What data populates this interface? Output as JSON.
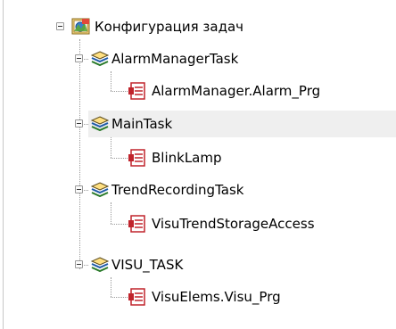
{
  "tree": {
    "root": {
      "label": "Конфигурация задач",
      "icon": "task-configuration-icon"
    },
    "tasks": [
      {
        "label": "AlarmManagerTask",
        "icon": "task-stack-icon",
        "children": [
          {
            "label": "AlarmManager.Alarm_Prg",
            "icon": "program-pou-icon"
          }
        ]
      },
      {
        "label": "MainTask",
        "icon": "task-stack-icon",
        "selected": true,
        "children": [
          {
            "label": "BlinkLamp",
            "icon": "program-pou-icon"
          }
        ]
      },
      {
        "label": "TrendRecordingTask",
        "icon": "task-stack-icon",
        "children": [
          {
            "label": "VisuTrendStorageAccess",
            "icon": "program-pou-icon"
          }
        ]
      },
      {
        "label": "VISU_TASK",
        "icon": "task-stack-icon",
        "children": [
          {
            "label": "VisuElems.Visu_Prg",
            "icon": "program-pou-icon"
          }
        ]
      }
    ]
  },
  "colors": {
    "highlight": "#efefef",
    "tree_lines": "#9a9a9a",
    "pou_red": "#c0242c"
  }
}
